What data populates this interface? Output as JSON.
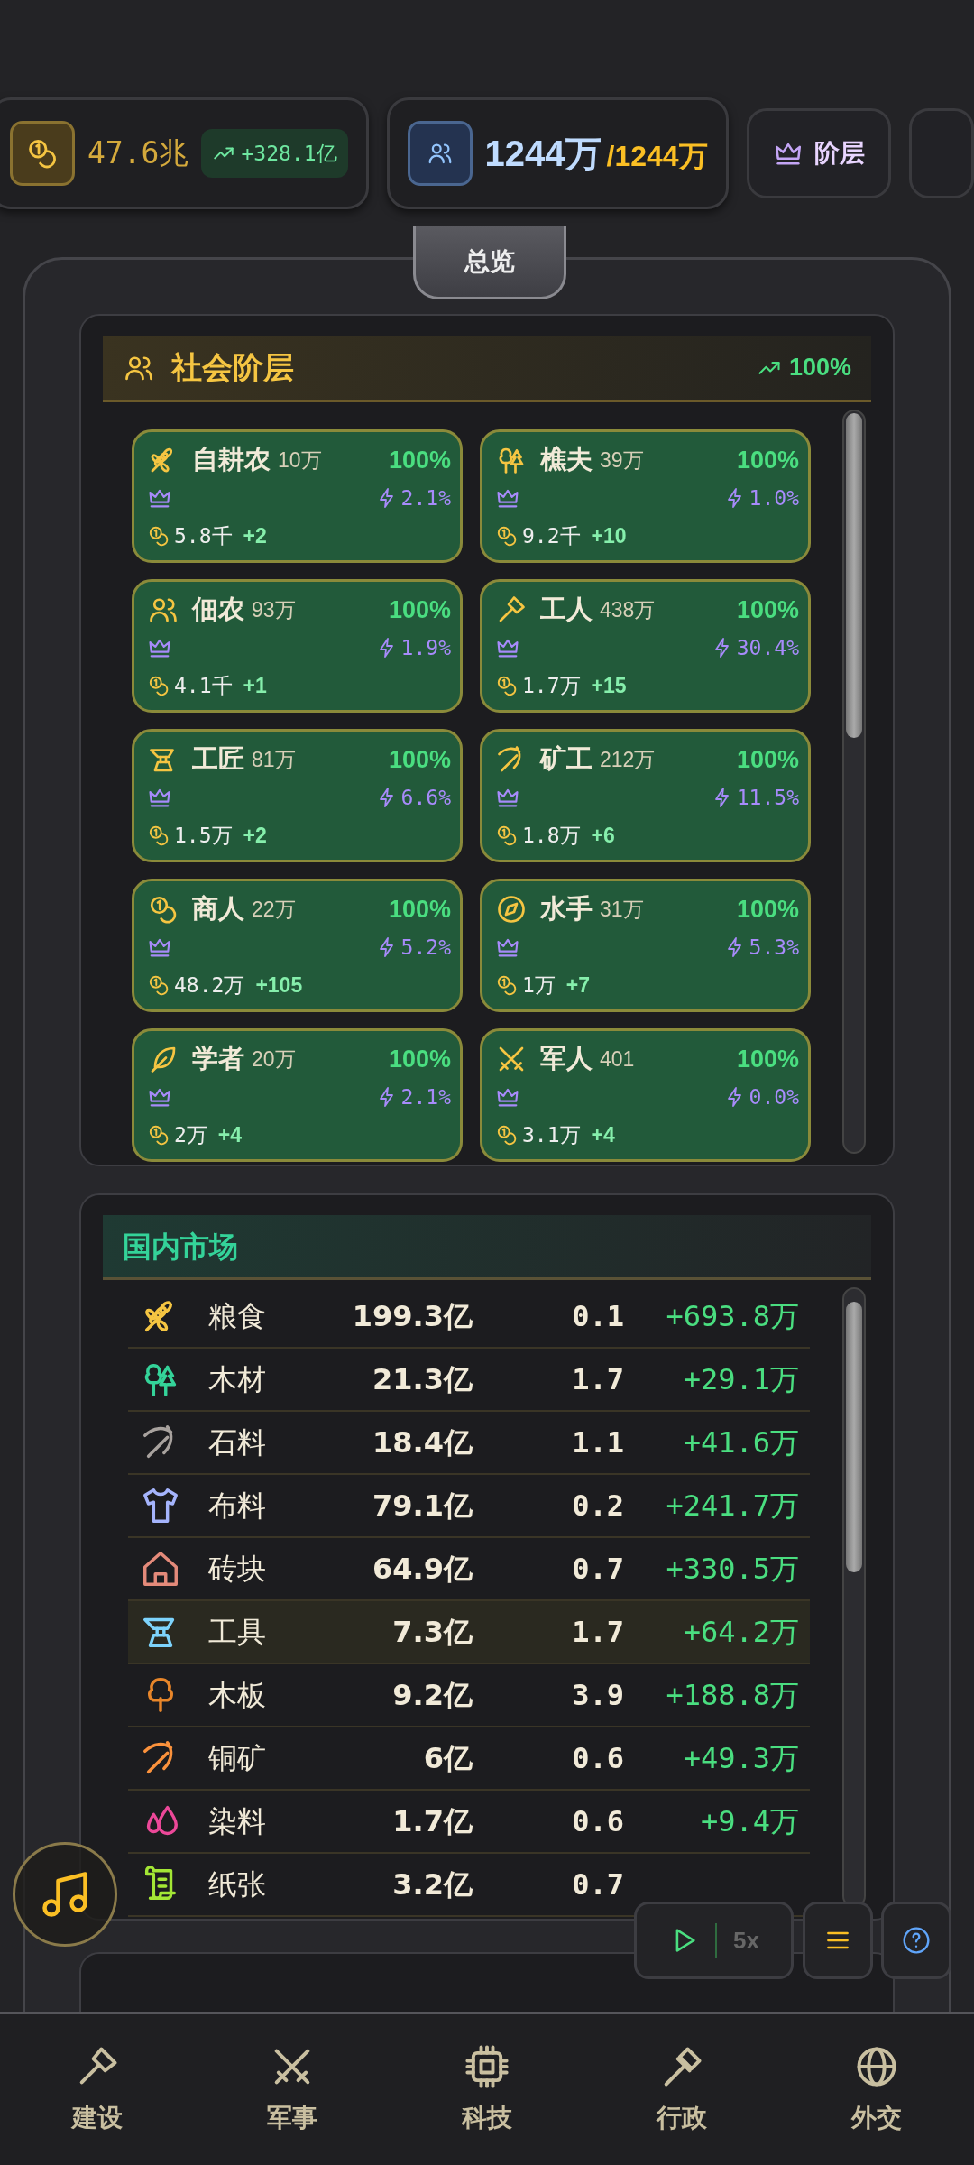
{
  "top_bar": {
    "treasury": {
      "amount": "47.6兆",
      "income": "+328.1亿"
    },
    "population": {
      "current": "1244万",
      "capacity": "/1244万"
    },
    "buttons": [
      {
        "label": "阶层"
      }
    ]
  },
  "tab": {
    "label": "总览",
    "selected": true
  },
  "social_classes": {
    "title": "社会阶层",
    "approval": "100%",
    "items": [
      {
        "kind": "wheat",
        "name": "自耕农",
        "population": "10万",
        "approval": "100%",
        "influence": "2.1%",
        "wealth": "5.8千",
        "wealth_change": "+2"
      },
      {
        "kind": "trees",
        "name": "樵夫",
        "population": "39万",
        "approval": "100%",
        "influence": "1.0%",
        "wealth": "9.2千",
        "wealth_change": "+10"
      },
      {
        "kind": "users",
        "name": "佃农",
        "population": "93万",
        "approval": "100%",
        "influence": "1.9%",
        "wealth": "4.1千",
        "wealth_change": "+1"
      },
      {
        "kind": "hammer",
        "name": "工人",
        "population": "438万",
        "approval": "100%",
        "influence": "30.4%",
        "wealth": "1.7万",
        "wealth_change": "+15"
      },
      {
        "kind": "anvil",
        "name": "工匠",
        "population": "81万",
        "approval": "100%",
        "influence": "6.6%",
        "wealth": "1.5万",
        "wealth_change": "+2"
      },
      {
        "kind": "pickaxe",
        "name": "矿工",
        "population": "212万",
        "approval": "100%",
        "influence": "11.5%",
        "wealth": "1.8万",
        "wealth_change": "+6"
      },
      {
        "kind": "coins",
        "name": "商人",
        "population": "22万",
        "approval": "100%",
        "influence": "5.2%",
        "wealth": "48.2万",
        "wealth_change": "+105"
      },
      {
        "kind": "compass",
        "name": "水手",
        "population": "31万",
        "approval": "100%",
        "influence": "5.3%",
        "wealth": "1万",
        "wealth_change": "+7"
      },
      {
        "kind": "feather",
        "name": "学者",
        "population": "20万",
        "approval": "100%",
        "influence": "2.1%",
        "wealth": "2万",
        "wealth_change": "+4"
      },
      {
        "kind": "swords",
        "name": "军人",
        "population": "401",
        "approval": "100%",
        "influence": "0.0%",
        "wealth": "3.1万",
        "wealth_change": "+4"
      }
    ]
  },
  "market": {
    "title": "国内市场",
    "rows": [
      {
        "kind": "wheat",
        "color": "#f5c542",
        "name": "粮食",
        "stock": "199.3亿",
        "price": "0.1",
        "change": "+693.8万",
        "selected": false
      },
      {
        "kind": "trees",
        "color": "#34d399",
        "name": "木材",
        "stock": "21.3亿",
        "price": "1.7",
        "change": "+29.1万",
        "selected": false
      },
      {
        "kind": "pickaxe",
        "color": "#a8a29e",
        "name": "石料",
        "stock": "18.4亿",
        "price": "1.1",
        "change": "+41.6万",
        "selected": false
      },
      {
        "kind": "shirt",
        "color": "#a5b4fc",
        "name": "布料",
        "stock": "79.1亿",
        "price": "0.2",
        "change": "+241.7万",
        "selected": false
      },
      {
        "kind": "house",
        "color": "#e48a7a",
        "name": "砖块",
        "stock": "64.9亿",
        "price": "0.7",
        "change": "+330.5万",
        "selected": false
      },
      {
        "kind": "anvil",
        "color": "#7dd3fc",
        "name": "工具",
        "stock": "7.3亿",
        "price": "1.7",
        "change": "+64.2万",
        "selected": true
      },
      {
        "kind": "tree",
        "color": "#e8862a",
        "name": "木板",
        "stock": "9.2亿",
        "price": "3.9",
        "change": "+188.8万",
        "selected": false
      },
      {
        "kind": "pickaxe",
        "color": "#fb923c",
        "name": "铜矿",
        "stock": "6亿",
        "price": "0.6",
        "change": "+49.3万",
        "selected": false
      },
      {
        "kind": "drops",
        "color": "#ec4899",
        "name": "染料",
        "stock": "1.7亿",
        "price": "0.6",
        "change": "+9.4万",
        "selected": false
      },
      {
        "kind": "scroll",
        "color": "#a3e635",
        "name": "纸张",
        "stock": "3.2亿",
        "price": "0.7",
        "selected": false
      }
    ]
  },
  "controls": {
    "speed": "5x"
  },
  "bottom_nav": [
    {
      "kind": "hammer",
      "label": "建设"
    },
    {
      "kind": "swords",
      "label": "军事"
    },
    {
      "kind": "chip",
      "label": "科技"
    },
    {
      "kind": "gavel",
      "label": "行政"
    },
    {
      "kind": "globe",
      "label": "外交"
    }
  ]
}
